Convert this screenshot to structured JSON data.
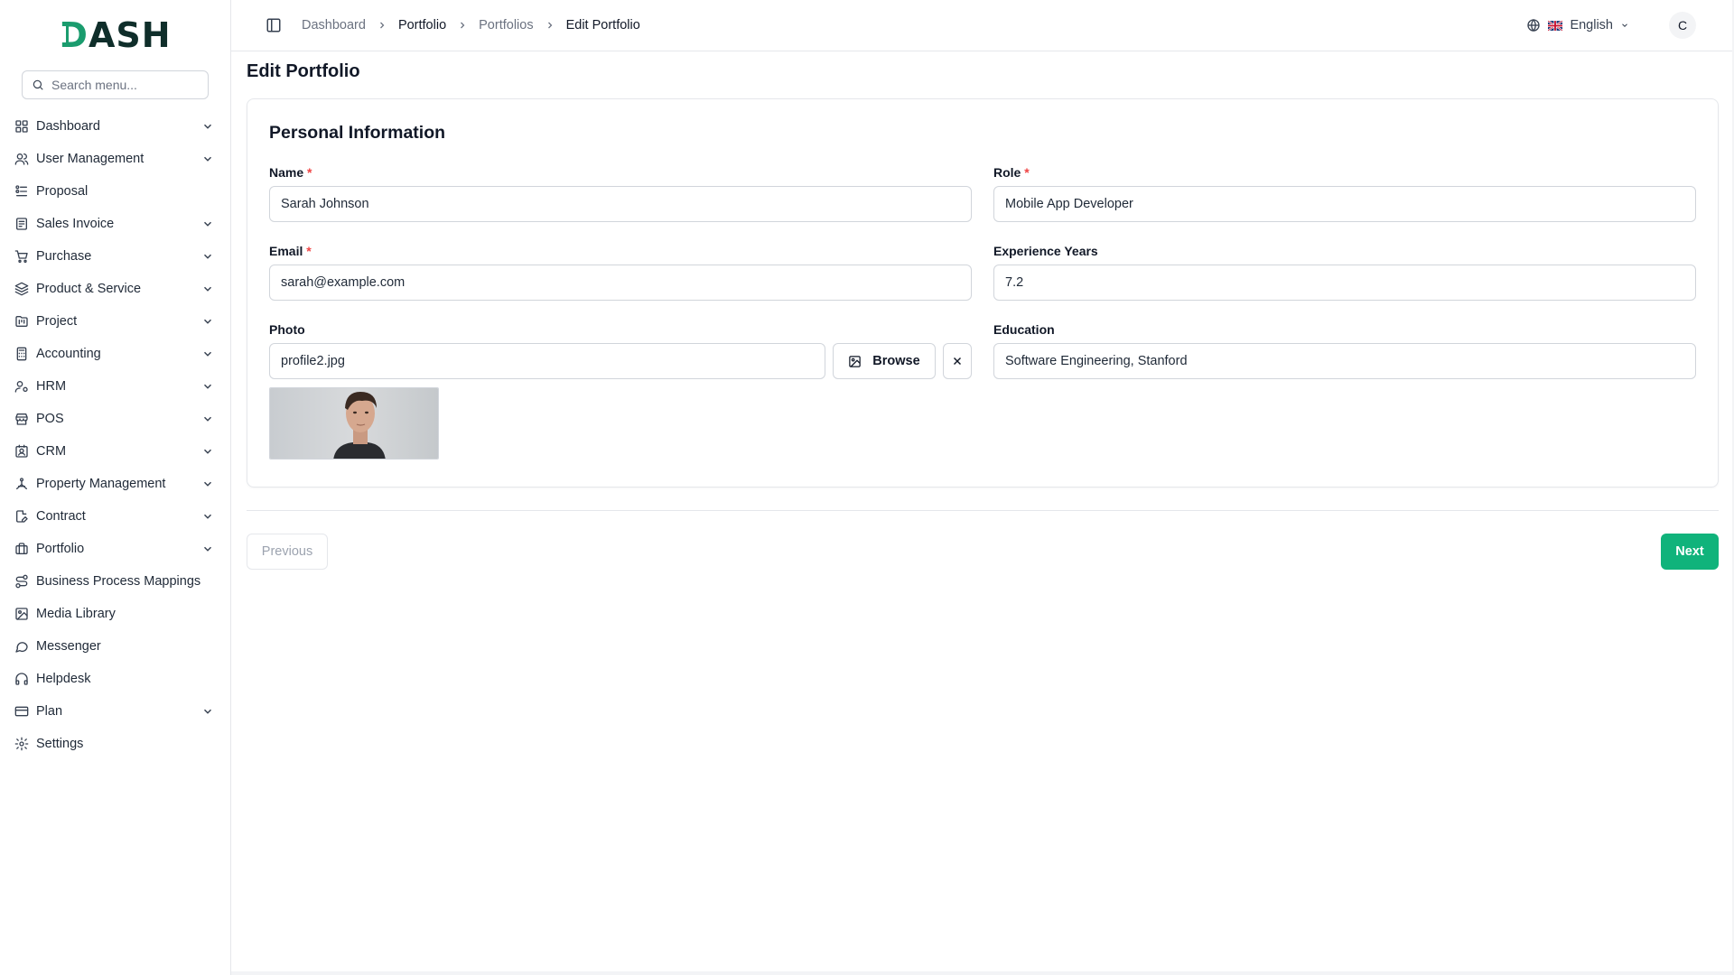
{
  "app": {
    "logo": "DASH"
  },
  "sidebar": {
    "search_placeholder": "Search menu...",
    "items": [
      {
        "label": "Dashboard",
        "icon": "grid-icon",
        "expandable": true
      },
      {
        "label": "User Management",
        "icon": "users-icon",
        "expandable": true
      },
      {
        "label": "Proposal",
        "icon": "proposal-icon",
        "expandable": false
      },
      {
        "label": "Sales Invoice",
        "icon": "invoice-icon",
        "expandable": true
      },
      {
        "label": "Purchase",
        "icon": "cart-icon",
        "expandable": true
      },
      {
        "label": "Product & Service",
        "icon": "layers-icon",
        "expandable": true
      },
      {
        "label": "Project",
        "icon": "folder-kanban-icon",
        "expandable": true
      },
      {
        "label": "Accounting",
        "icon": "calculator-icon",
        "expandable": true
      },
      {
        "label": "HRM",
        "icon": "user-cog-icon",
        "expandable": true
      },
      {
        "label": "POS",
        "icon": "store-icon",
        "expandable": true
      },
      {
        "label": "CRM",
        "icon": "contact-icon",
        "expandable": true
      },
      {
        "label": "Property Management",
        "icon": "building-icon",
        "expandable": true
      },
      {
        "label": "Contract",
        "icon": "file-pen-icon",
        "expandable": true
      },
      {
        "label": "Portfolio",
        "icon": "briefcase-icon",
        "expandable": true
      },
      {
        "label": "Business Process Mappings",
        "icon": "route-icon",
        "expandable": false
      },
      {
        "label": "Media Library",
        "icon": "image-icon",
        "expandable": false
      },
      {
        "label": "Messenger",
        "icon": "message-icon",
        "expandable": false
      },
      {
        "label": "Helpdesk",
        "icon": "headphones-icon",
        "expandable": false
      },
      {
        "label": "Plan",
        "icon": "credit-card-icon",
        "expandable": true
      },
      {
        "label": "Settings",
        "icon": "gear-icon",
        "expandable": false
      }
    ]
  },
  "topbar": {
    "breadcrumbs": [
      "Dashboard",
      "Portfolio",
      "Portfolios",
      "Edit Portfolio"
    ],
    "language": "English",
    "avatar_initial": "C"
  },
  "page": {
    "title": "Edit Portfolio",
    "section_title": "Personal Information",
    "fields": {
      "name": {
        "label": "Name",
        "value": "Sarah Johnson",
        "required": "*"
      },
      "role": {
        "label": "Role",
        "value": "Mobile App Developer",
        "required": "*"
      },
      "email": {
        "label": "Email",
        "value": "sarah@example.com",
        "required": "*"
      },
      "experience": {
        "label": "Experience Years",
        "value": "7.2"
      },
      "photo": {
        "label": "Photo",
        "value": "profile2.jpg",
        "browse_label": "Browse"
      },
      "education": {
        "label": "Education",
        "value": "Software Engineering, Stanford"
      }
    },
    "actions": {
      "previous": "Previous",
      "next": "Next"
    }
  },
  "colors": {
    "accent": "#10b37b",
    "required": "#ef4444",
    "border": "#d1d5db"
  }
}
